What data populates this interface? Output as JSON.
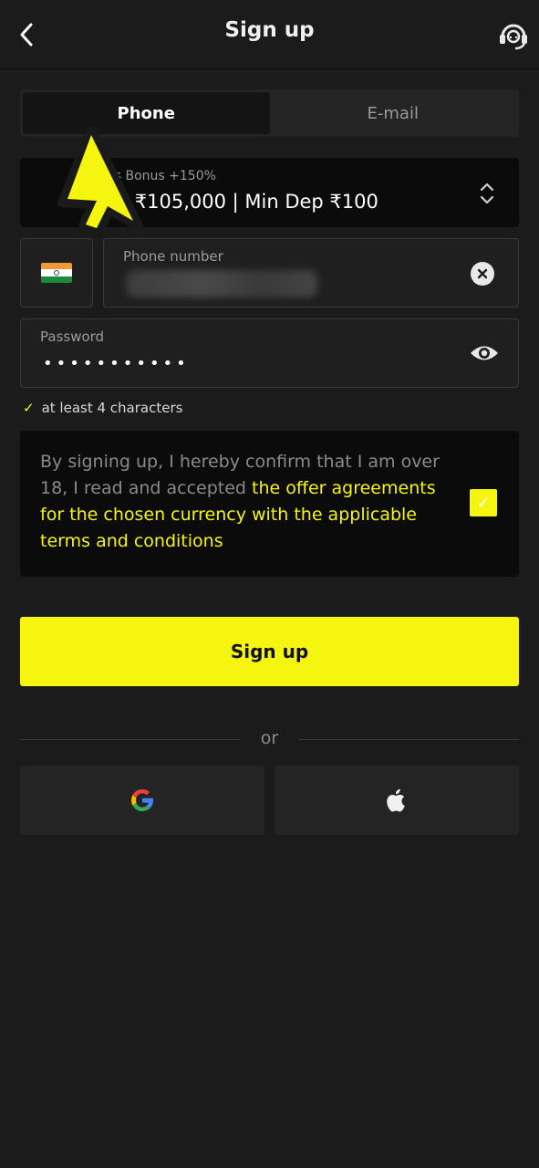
{
  "header": {
    "title": "Sign up"
  },
  "tabs": [
    {
      "label": "Phone",
      "active": true
    },
    {
      "label": "E-mail",
      "active": false
    }
  ],
  "bonus": {
    "label": "rs Bonus +150%",
    "value": "to ₹105,000 | Min Dep ₹100"
  },
  "phone": {
    "label": "Phone number",
    "country_flag": "india-flag"
  },
  "password": {
    "label": "Password",
    "value": "•••••••••••"
  },
  "hint": {
    "check": "✓",
    "text": "at least 4 characters"
  },
  "terms": {
    "plain": "By signing up, I hereby confirm that I am over 18, I read and accepted ",
    "highlight": "the offer agreements for the chosen currency with the applicable terms and conditions",
    "checked": true,
    "check_mark": "✓"
  },
  "actions": {
    "signup_label": "Sign up",
    "divider_label": "or"
  },
  "colors": {
    "accent": "#f5f510",
    "background": "#1b1b1b",
    "panel": "#0b0b0b"
  }
}
